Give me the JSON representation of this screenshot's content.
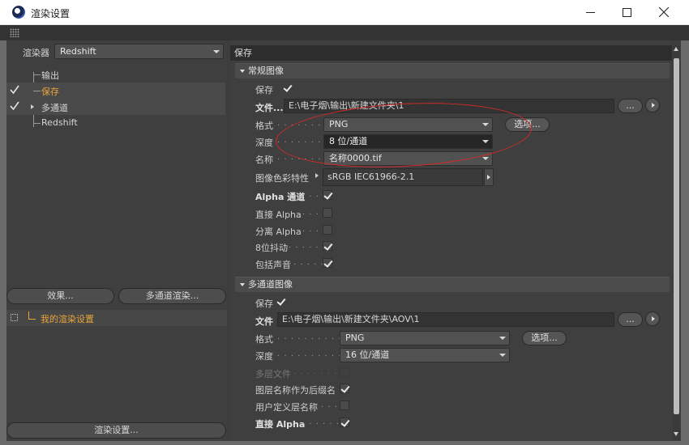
{
  "window": {
    "title": "渲染设置"
  },
  "left": {
    "renderer_label": "渲染器",
    "renderer_value": "Redshift",
    "tree": [
      {
        "label": "输出",
        "checked": false,
        "color": "#cfcfcf"
      },
      {
        "label": "保存",
        "checked": true,
        "color": "#e8a43a"
      },
      {
        "label": "多通道",
        "checked": true,
        "color": "#cfcfcf"
      },
      {
        "label": "Redshift",
        "checked": false,
        "color": "#cfcfcf"
      }
    ],
    "effects_button": "效果...",
    "multipass_render_button": "多通道渲染...",
    "preset_label": "我的渲染设置",
    "render_settings_button": "渲染设置..."
  },
  "right": {
    "header": "保存",
    "regular": {
      "title": "常规图像",
      "save_label": "保存",
      "file_label": "文件...",
      "file_value": "E:\\电子烟\\输出\\新建文件夹\\1",
      "file_browse": "...",
      "format_label": "格式",
      "format_value": "PNG",
      "options_button": "选项...",
      "depth_label": "深度",
      "depth_value": "8 位/通道",
      "name_label": "名称",
      "name_value": "名称0000.tif",
      "profile_label": "图像色彩特性",
      "profile_value": "sRGB IEC61966-2.1",
      "alpha_label": "Alpha 通道",
      "straight_alpha_label": "直接 Alpha",
      "separate_alpha_label": "分离 Alpha",
      "dither_label": "8位抖动",
      "sound_label": "包括声音",
      "checks": {
        "save": true,
        "alpha": true,
        "straight_alpha": false,
        "separate_alpha": false,
        "dither": true,
        "sound": true
      }
    },
    "multipass": {
      "title": "多通道图像",
      "save_label": "保存",
      "file_label": "文件",
      "file_value": "E:\\电子烟\\输出\\新建文件夹\\AOV\\1",
      "file_browse": "...",
      "format_label": "格式",
      "format_value": "PNG",
      "options_button": "选项...",
      "depth_label": "深度",
      "depth_value": "16 位/通道",
      "layer_file_label": "多层文件",
      "layer_suffix_label": "图层名称作为后缀名",
      "user_layer_label": "用户定义层名称",
      "straight_alpha_label": "直接 Alpha",
      "checks": {
        "save": true,
        "layer_file": false,
        "layer_suffix": true,
        "user_layer": false,
        "straight_alpha": true
      }
    }
  },
  "colors": {
    "accent": "#e8a43a",
    "annotation": "#d32a2a"
  }
}
